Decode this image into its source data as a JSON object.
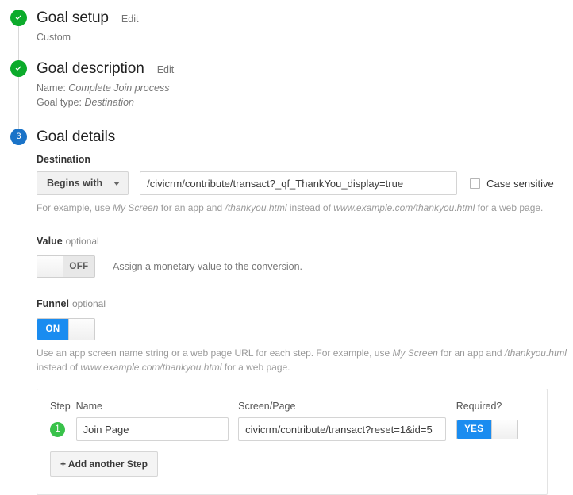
{
  "colors": {
    "done_green": "#0cab2b",
    "current_blue": "#1a73c8",
    "toggle_on_blue": "#1a8cf0",
    "step_badge_green": "#39c24a"
  },
  "steps": {
    "goal_setup": {
      "title": "Goal setup",
      "edit_label": "Edit",
      "summary": "Custom",
      "marker_icon": "check-icon"
    },
    "goal_description": {
      "title": "Goal description",
      "edit_label": "Edit",
      "name_prefix": "Name: ",
      "name_value": "Complete Join process",
      "type_prefix": "Goal type: ",
      "type_value": "Destination",
      "marker_icon": "check-icon"
    },
    "goal_details": {
      "title": "Goal details",
      "marker_number": "3"
    }
  },
  "destination": {
    "label": "Destination",
    "match_type": "Begins with",
    "match_caret_icon": "chevron-down-icon",
    "value": "/civicrm/contribute/transact?_qf_ThankYou_display=true",
    "placeholder": "",
    "case_sensitive_label": "Case sensitive",
    "case_sensitive_checked": false,
    "hint_parts": {
      "a": "For example, use ",
      "b": "My Screen",
      "c": " for an app and ",
      "d": "/thankyou.html",
      "e": " instead of ",
      "f": "www.example.com/thankyou.html",
      "g": " for a web page."
    }
  },
  "value_section": {
    "label": "Value",
    "optional": "optional",
    "toggle_state": "OFF",
    "description": "Assign a monetary value to the conversion."
  },
  "funnel_section": {
    "label": "Funnel",
    "optional": "optional",
    "toggle_state": "ON",
    "hint_parts": {
      "a": "Use an app screen name string or a web page URL for each step. For example, use ",
      "b": "My Screen",
      "c": " for an app and ",
      "d": "/thankyou.html",
      "e": " instead of ",
      "f": "www.example.com/thankyou.html",
      "g": " for a web page."
    },
    "table": {
      "headers": {
        "step": "Step",
        "name": "Name",
        "screen": "Screen/Page",
        "required": "Required?"
      },
      "rows": [
        {
          "number": "1",
          "name": "Join Page",
          "screen": "civicrm/contribute/transact?reset=1&id=5",
          "required_state": "YES"
        }
      ]
    },
    "add_step_label": "+ Add another Step"
  }
}
